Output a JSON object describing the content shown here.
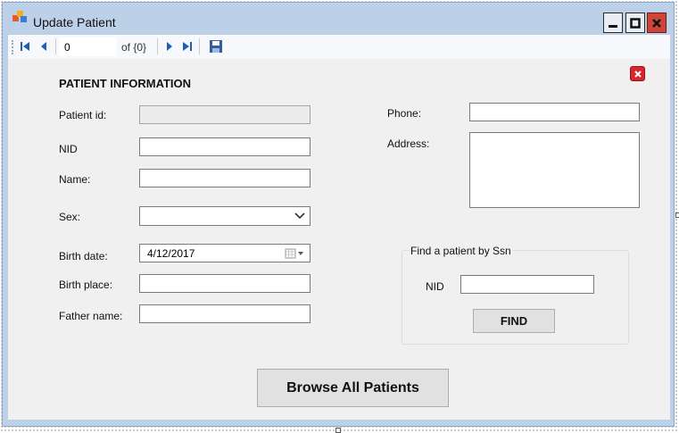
{
  "window": {
    "title": "Update Patient",
    "accent_color": "#bcd0e8",
    "close_color": "#d0453a"
  },
  "navigator": {
    "position_value": "0",
    "count_text": "of {0}",
    "icons": [
      "move-first-icon",
      "move-previous-icon",
      "move-next-icon",
      "move-last-icon",
      "save-icon"
    ]
  },
  "form": {
    "section_title": "PATIENT INFORMATION",
    "patient_id_label": "Patient id:",
    "patient_id_value": "",
    "nid_label": "NID",
    "nid_value": "",
    "name_label": "Name:",
    "name_value": "",
    "sex_label": "Sex:",
    "sex_value": "",
    "birth_date_label": "Birth date:",
    "birth_date_value": "4/12/2017",
    "birth_place_label": "Birth place:",
    "birth_place_value": "",
    "father_name_label": "Father name:",
    "father_name_value": "",
    "phone_label": "Phone:",
    "phone_value": "",
    "address_label": "Address:",
    "address_value": ""
  },
  "search": {
    "group_title": "Find a patient by Ssn",
    "nid_label": "NID",
    "nid_value": "",
    "find_button": "FIND"
  },
  "browse_button": "Browse All Patients"
}
